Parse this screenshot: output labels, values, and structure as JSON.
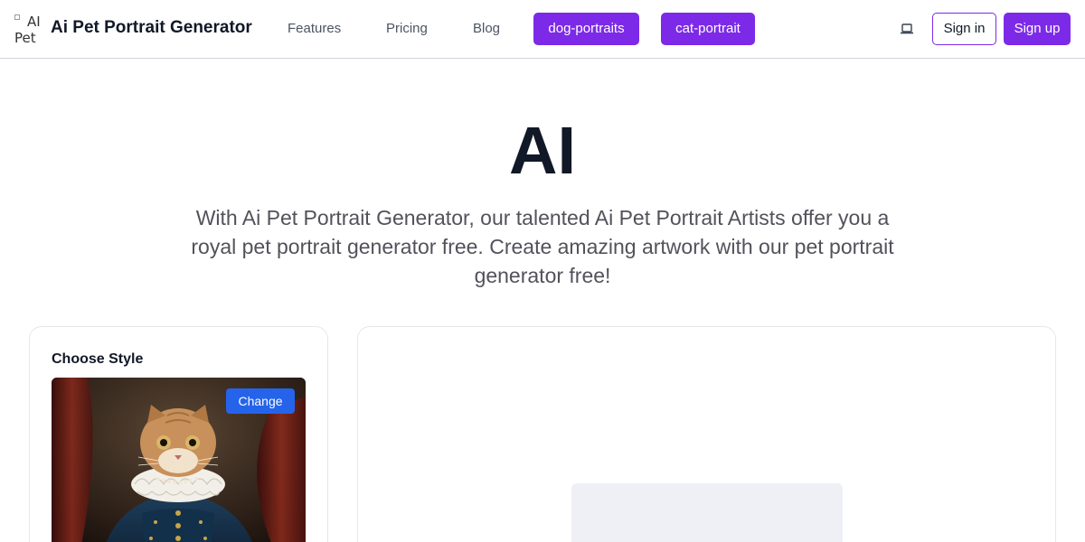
{
  "header": {
    "logo_alt_line1": "AI",
    "logo_alt_line2": "Pet",
    "brand": "Ai Pet Portrait Generator",
    "nav": [
      {
        "label": "Features"
      },
      {
        "label": "Pricing"
      },
      {
        "label": "Blog"
      }
    ],
    "pills": [
      {
        "label": "dog-portraits"
      },
      {
        "label": "cat-portrait"
      }
    ],
    "theme_icon": "laptop-icon",
    "sign_in": "Sign in",
    "sign_up": "Sign up"
  },
  "hero": {
    "title": "AI",
    "description": "With Ai Pet Portrait Generator, our talented Ai Pet Portrait Artists offer you a royal pet portrait generator free. Create amazing artwork with our pet portrait generator free!"
  },
  "style_card": {
    "title": "Choose Style",
    "change_label": "Change",
    "image_icon": "cat-royal-portrait-image"
  },
  "colors": {
    "accent": "#7c2ae8",
    "change_button": "#2563eb",
    "placeholder": "#eef0f5"
  }
}
